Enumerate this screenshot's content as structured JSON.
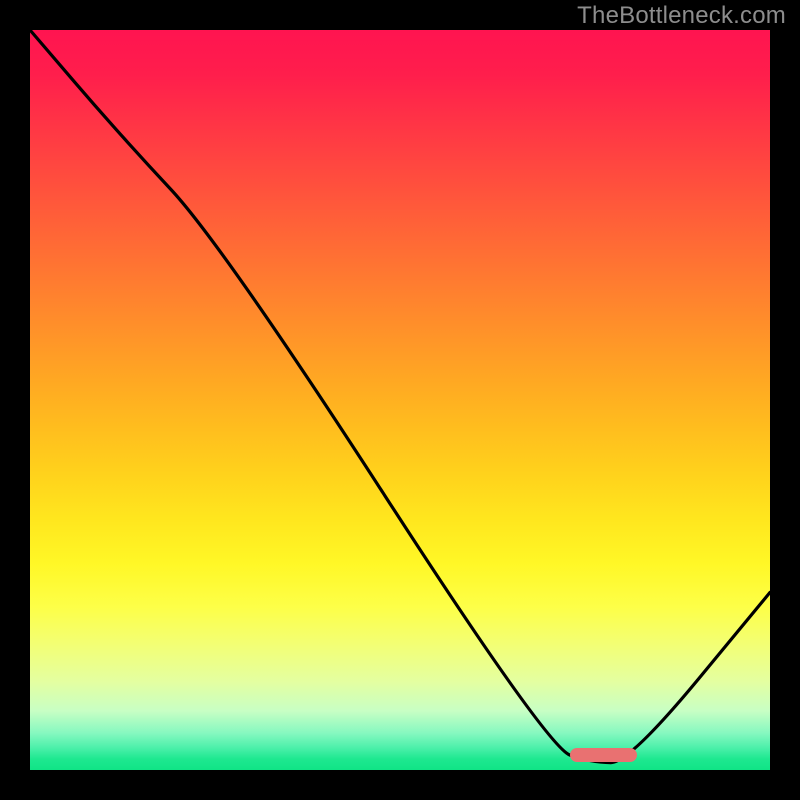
{
  "watermark": "TheBottleneck.com",
  "chart_data": {
    "type": "line",
    "title": "",
    "xlabel": "",
    "ylabel": "",
    "xlim": [
      0,
      100
    ],
    "ylim": [
      0,
      100
    ],
    "grid": false,
    "series": [
      {
        "name": "bottleneck-curve",
        "x": [
          0,
          12,
          26,
          70,
          76,
          81,
          100
        ],
        "values": [
          100,
          86,
          71,
          3,
          1,
          1,
          24
        ]
      }
    ],
    "annotations": [
      {
        "name": "sweet-spot-marker",
        "x_start": 73,
        "x_end": 82,
        "y": 2
      }
    ]
  },
  "colors": {
    "curve": "#000000",
    "marker": "#e97171",
    "frame": "#000000"
  }
}
